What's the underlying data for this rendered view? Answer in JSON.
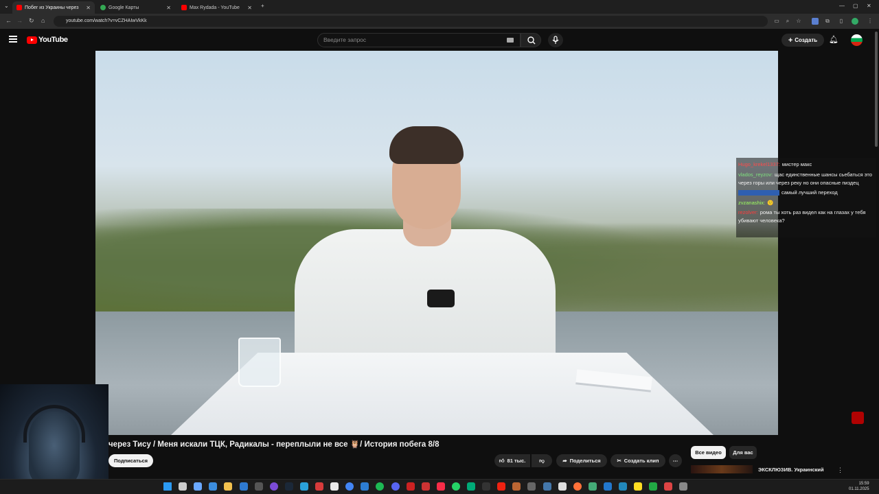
{
  "browser": {
    "tabs": [
      {
        "label": "Побег из Украины через",
        "favicon_color": "#ff0000",
        "active": true
      },
      {
        "label": "Google Карты",
        "favicon_color": "#34a853",
        "active": false
      },
      {
        "label": "Max Rydada - YouTube",
        "favicon_color": "#ff0000",
        "active": false
      }
    ],
    "new_tab": "+",
    "url": "youtube.com/watch?v=vCZHAIwVkKk",
    "window_controls": [
      "—",
      "▢",
      "✕"
    ]
  },
  "youtube": {
    "logo_text": "YouTube",
    "search_placeholder": "Введите запрос",
    "create_label": "Создать",
    "brand_color": "#ff0000"
  },
  "video": {
    "title": "через Тису / Меня искали ТЦК, Радикалы - переплыли не все 🦉/ История побега 8/8",
    "subscribe_label": "Подписаться",
    "likes": "81 тыс.",
    "share_label": "Поделиться",
    "clip_label": "Создать клип",
    "more_label": "⋯"
  },
  "chat": [
    {
      "name": "Hugo_krekel1337:",
      "name_color": "#ff4b4b",
      "text": "мистер макс"
    },
    {
      "name": "vlados_reyzov:",
      "name_color": "#7fe07f",
      "text": "щас единственные шансы сьебаться это через горы или через реку но они опасные пиздец"
    },
    {
      "name": "",
      "name_color": "#4aa0ff",
      "text": "самый лучший переход"
    },
    {
      "name": "zvzanashix:",
      "name_color": "#9eff5f",
      "text": "🙂"
    },
    {
      "name": "rezolver:",
      "name_color": "#ff3c3c",
      "text": "рома ты хоть раз видел как на глазах у тебя убивают человека?"
    }
  ],
  "sidebar": {
    "chips": [
      "Все видео",
      "Для вас"
    ],
    "recommendation_title": "ЭКСКЛЮЗИВ. Украинский солдат рассказывает о",
    "more_icon": "⋮"
  },
  "taskbar": {
    "time": "15:59",
    "date": "01.11.2025",
    "icons": [
      "windows-icon",
      "search-icon",
      "desktop-icon",
      "explorer-icon",
      "folder-icon",
      "store-icon",
      "terminal-icon",
      "obs-icon",
      "steam-icon",
      "telegram-icon",
      "app-icon",
      "browser-yandex-icon",
      "chrome-icon",
      "vscode-icon",
      "spotify-icon",
      "discord-icon",
      "app-icon",
      "app-icon",
      "music-icon",
      "whatsapp-icon",
      "app-icon",
      "terminal-icon",
      "counter-icon",
      "app-icon",
      "app-icon",
      "app-icon",
      "app-icon",
      "firefox-icon",
      "app-icon",
      "app-icon",
      "app-icon",
      "app-icon",
      "app-icon",
      "app-icon",
      "app-icon"
    ]
  }
}
